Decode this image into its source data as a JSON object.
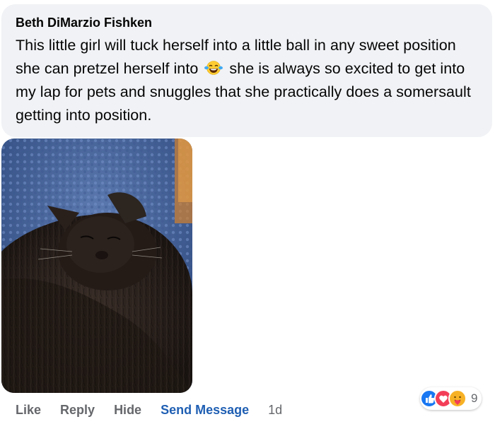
{
  "comment": {
    "author": "Beth DiMarzio Fishken",
    "text_part1": "This little girl will tuck herself into a little ball in any sweet position she can pretzel herself into",
    "text_part2": "she is always so excited to get into my lap for pets and snuggles that she practically does a somersault getting into position.",
    "emoji": "laughing-tears-emoji"
  },
  "actions": {
    "like": "Like",
    "reply": "Reply",
    "hide": "Hide",
    "send_message": "Send Message",
    "timestamp": "1d"
  },
  "reactions": {
    "count": "9",
    "icons": [
      "like-icon",
      "love-icon",
      "care-icon"
    ]
  },
  "colors": {
    "bubble_bg": "#f0f2f5",
    "link_blue": "#1f5fb3",
    "muted_gray": "#65676b"
  }
}
